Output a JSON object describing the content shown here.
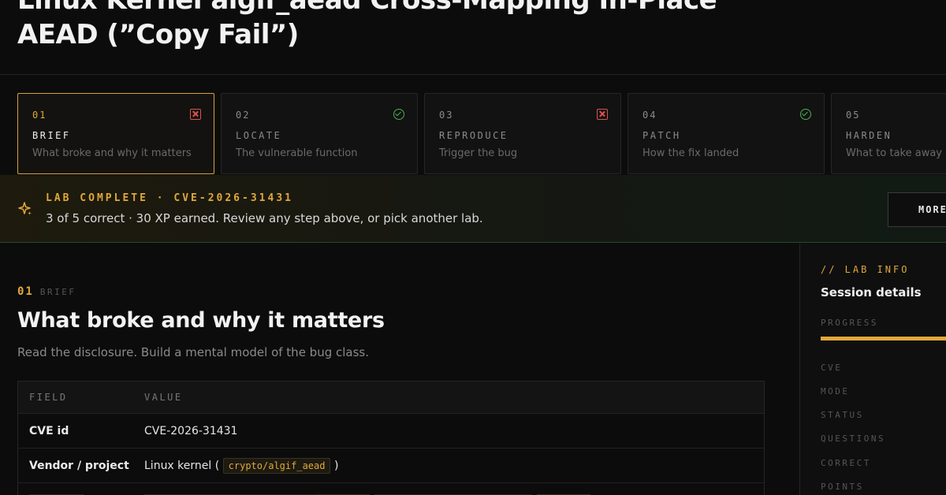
{
  "page": {
    "title_line1": "Linux Kernel algif_aead Cross-Mapping In-Place",
    "title_line2": "AEAD (”Copy Fail”)"
  },
  "steps": [
    {
      "num": "01",
      "name": "BRIEF",
      "desc": "What broke and why it matters",
      "status": "fail",
      "icon": "x-square-icon",
      "active": true
    },
    {
      "num": "02",
      "name": "LOCATE",
      "desc": "The vulnerable function",
      "status": "pass",
      "icon": "check-circle-icon",
      "active": false
    },
    {
      "num": "03",
      "name": "REPRODUCE",
      "desc": "Trigger the bug",
      "status": "fail",
      "icon": "x-square-icon",
      "active": false
    },
    {
      "num": "04",
      "name": "PATCH",
      "desc": "How the fix landed",
      "status": "pass",
      "icon": "check-circle-icon",
      "active": false
    },
    {
      "num": "05",
      "name": "HARDEN",
      "desc": "What to take away",
      "status": "none",
      "icon": "",
      "active": false
    }
  ],
  "banner": {
    "icon": "sparkle-icon",
    "label": "LAB COMPLETE · CVE-2026-31431",
    "text": "3 of 5 correct · 30 XP earned. Review any step above, or pick another lab.",
    "button": "MORE"
  },
  "section": {
    "num": "01",
    "tag": "BRIEF",
    "title": "What broke and why it matters",
    "subtitle": "Read the disclosure. Build a mental model of the bug class.",
    "table": {
      "headers": [
        "FIELD",
        "VALUE"
      ],
      "rows": [
        {
          "field": "CVE id",
          "value": "CVE-2026-31431"
        },
        {
          "field": "Vendor / project",
          "value_prefix": "Linux kernel (",
          "value_code": "crypto/algif_aead",
          "value_suffix": ")"
        }
      ]
    }
  },
  "sidebar": {
    "eyebrow": "// LAB INFO",
    "title": "Session details",
    "progress_label": "PROGRESS",
    "progress_fraction": 1.0,
    "rows": [
      "CVE",
      "MODE",
      "STATUS",
      "QUESTIONS",
      "CORRECT",
      "POINTS"
    ]
  },
  "colors": {
    "accent": "#e0a83a",
    "fail": "#d9534f",
    "pass": "#4caf50",
    "background": "#0c0c0c"
  }
}
